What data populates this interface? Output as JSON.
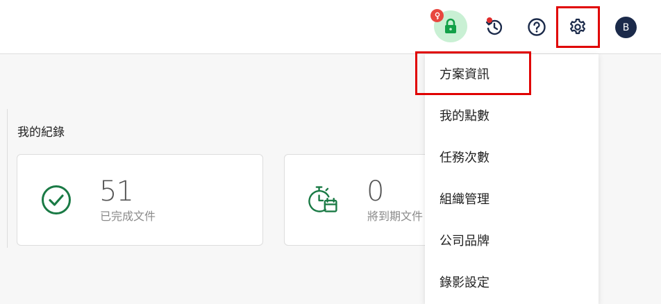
{
  "header": {
    "avatar_initial": "B",
    "icons": {
      "lock": "lock-icon",
      "lock_badge": "key-icon",
      "history": "clock-history-icon",
      "help": "help-circle-icon",
      "settings": "gear-icon"
    },
    "colors": {
      "lock_bg": "#c9f0d4",
      "lock_fg": "#12a048",
      "badge": "#e8473f",
      "avatar_bg": "#1b2a4a",
      "highlight": "#e00000"
    }
  },
  "records": {
    "title": "我的紀錄",
    "cards": [
      {
        "value": "51",
        "label": "已完成文件",
        "icon": "check-circle-icon"
      },
      {
        "value": "0",
        "label": "將到期文件",
        "icon": "timer-calendar-icon"
      }
    ],
    "accent": "#1a7a45"
  },
  "settings_menu": {
    "items": [
      {
        "label": "方案資訊"
      },
      {
        "label": "我的點數"
      },
      {
        "label": "任務次數"
      },
      {
        "label": "組織管理"
      },
      {
        "label": "公司品牌"
      },
      {
        "label": "錄影設定"
      }
    ]
  }
}
